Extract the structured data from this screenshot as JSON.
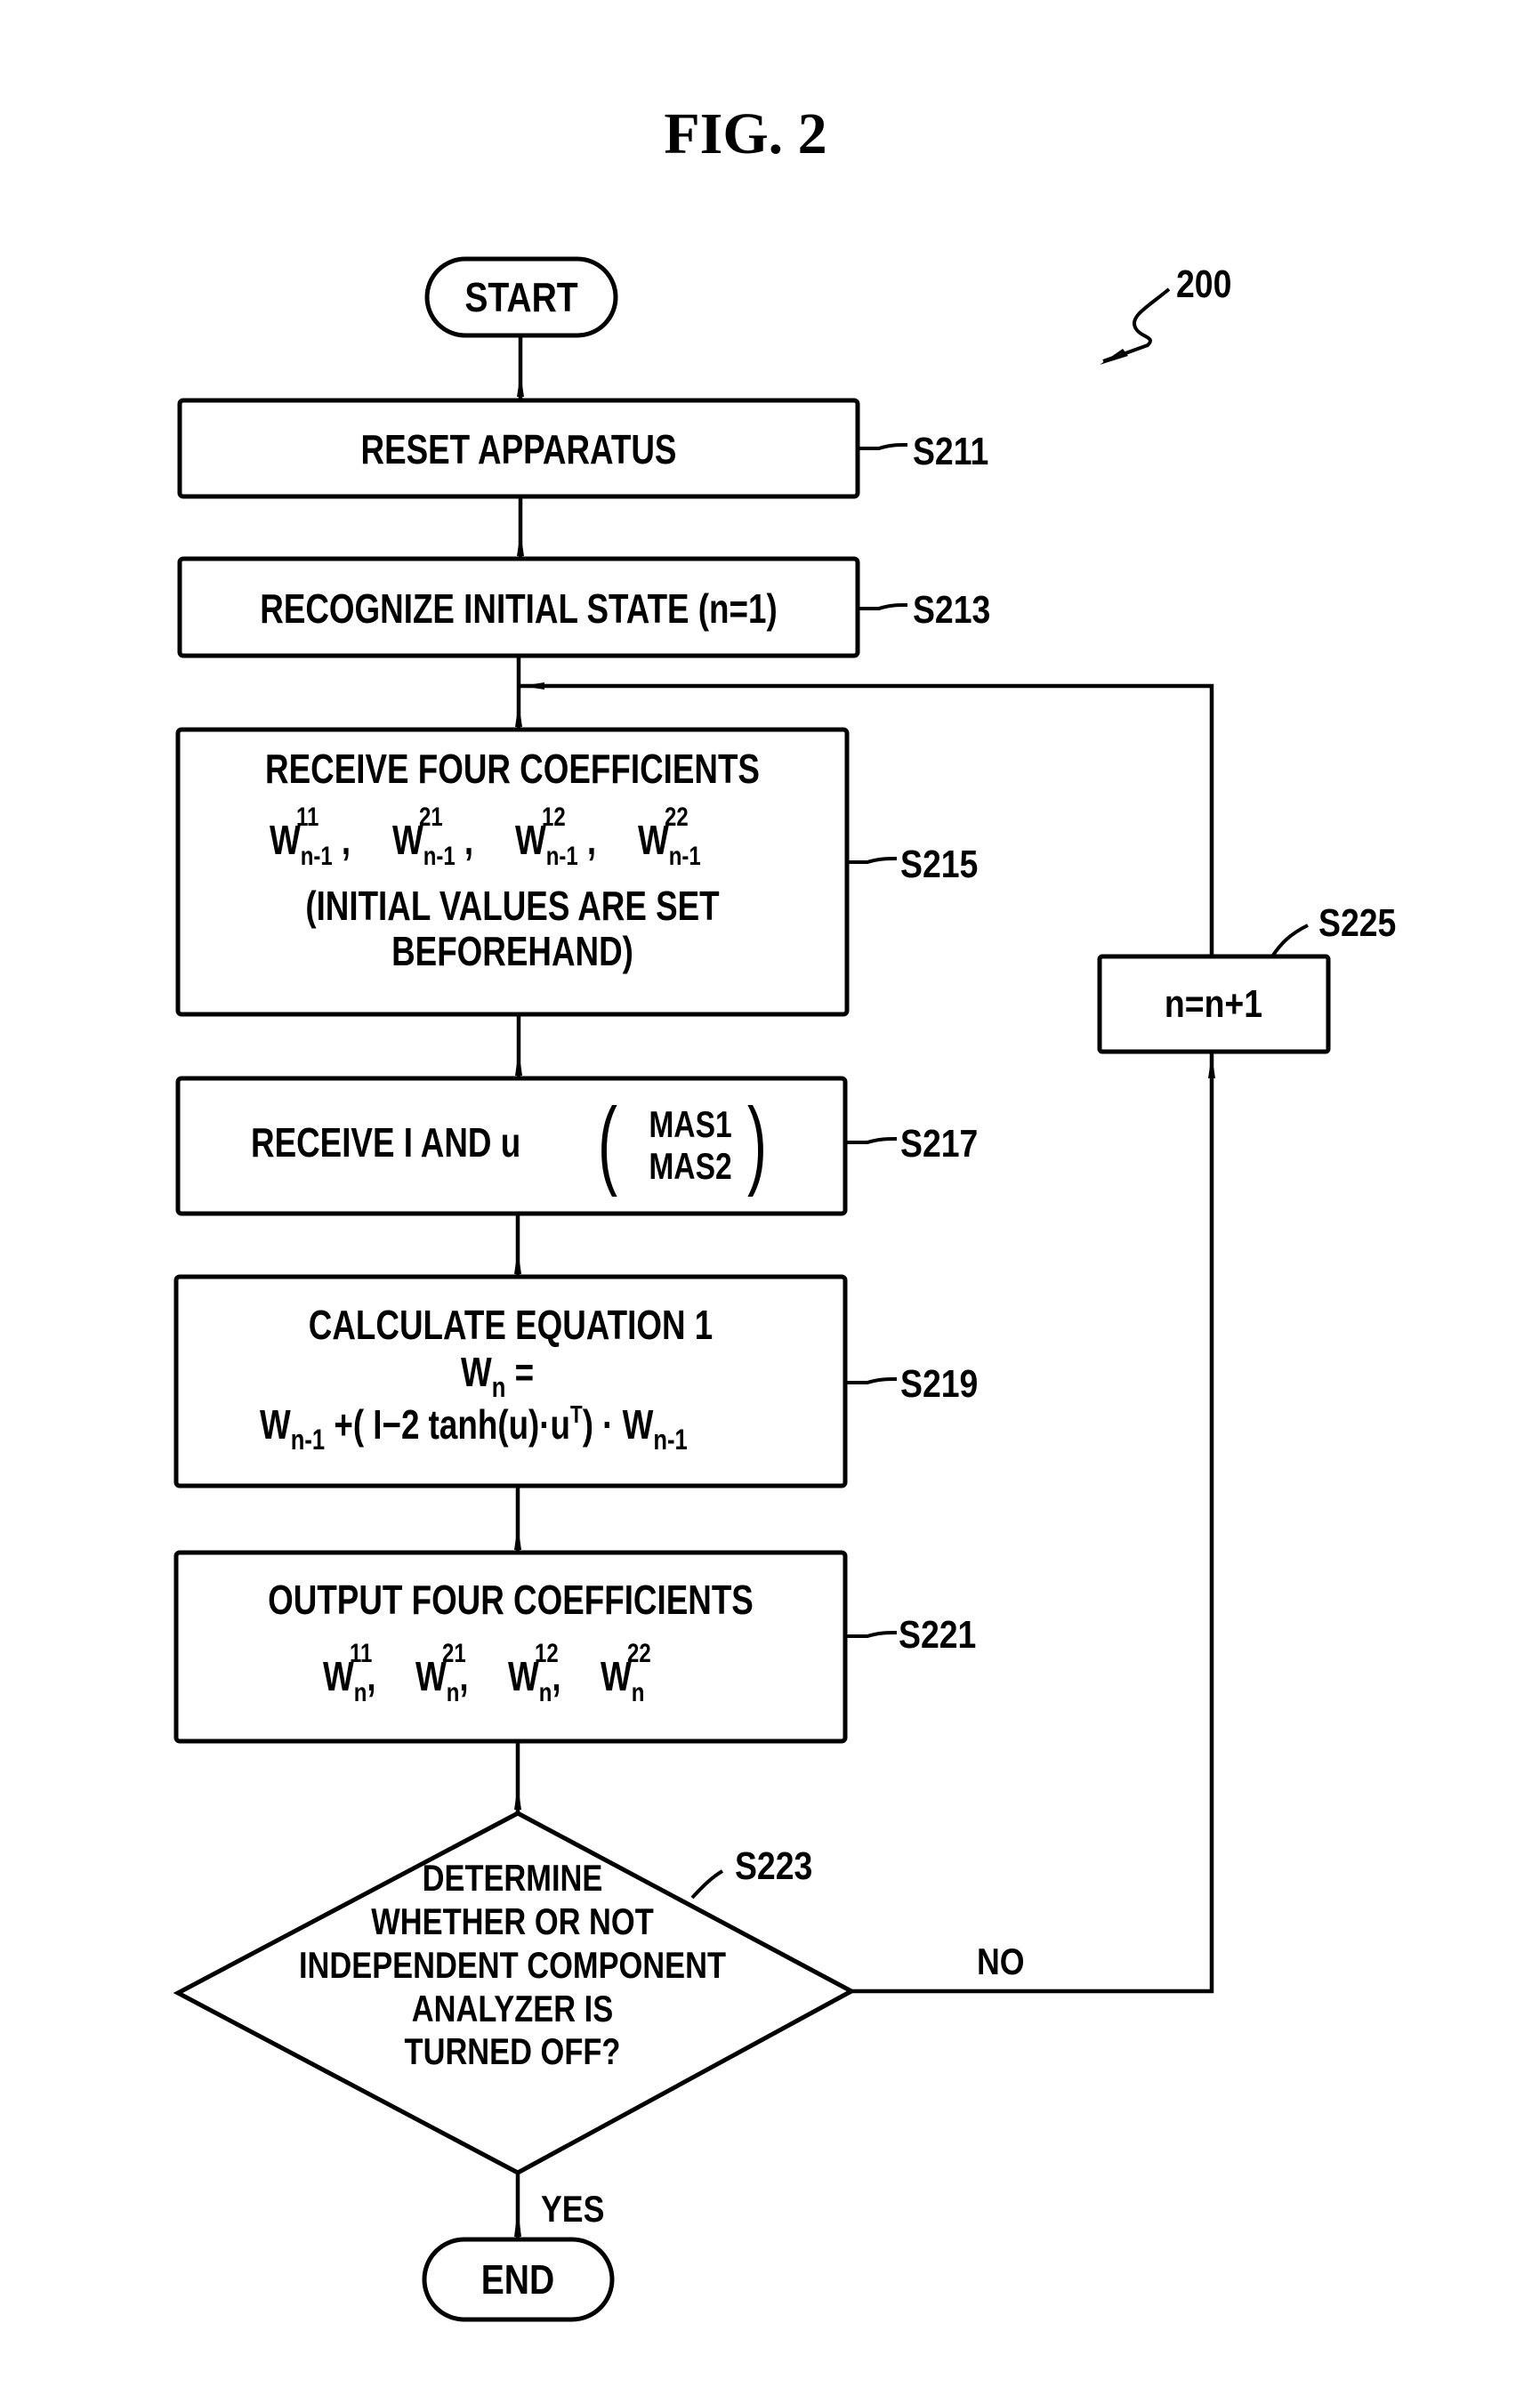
{
  "figure": {
    "title": "FIG. 2",
    "reference_number": "200"
  },
  "flowchart": {
    "start": {
      "label": "START"
    },
    "end": {
      "label": "END"
    },
    "steps": [
      {
        "id": "S211",
        "lines": [
          "RESET APPARATUS"
        ]
      },
      {
        "id": "S213",
        "lines": [
          "RECOGNIZE INITIAL STATE (n=1)"
        ]
      },
      {
        "id": "S215",
        "lines": [
          "RECEIVE FOUR COEFFICIENTS",
          "W¹¹ₙ₋₁ , W²¹ₙ₋₁ , W¹²ₙ₋₁ , W²²ₙ₋₁",
          "(INITIAL VALUES ARE SET",
          "BEFOREHAND)"
        ],
        "coefficients": [
          {
            "base": "W",
            "sup": "11",
            "sub": "n-1"
          },
          {
            "base": "W",
            "sup": "21",
            "sub": "n-1"
          },
          {
            "base": "W",
            "sup": "12",
            "sub": "n-1"
          },
          {
            "base": "W",
            "sup": "22",
            "sub": "n-1"
          }
        ],
        "text_top": "RECEIVE FOUR COEFFICIENTS",
        "text_bottom_1": "(INITIAL VALUES ARE SET",
        "text_bottom_2": "BEFOREHAND)"
      },
      {
        "id": "S217",
        "text": "RECEIVE I AND u",
        "paren_top": "MAS1",
        "paren_bottom": "MAS2"
      },
      {
        "id": "S219",
        "line1": "CALCULATE EQUATION 1",
        "line2_base": "W",
        "line2_sub": "n",
        "line2_rest": " =",
        "line3": {
          "w1_sub": "n-1",
          "middle": " +( I−2 tanh(u)·u",
          "sup_T": "T",
          "close": ") · W",
          "w2_sub": "n-1"
        }
      },
      {
        "id": "S221",
        "text_top": "OUTPUT FOUR COEFFICIENTS",
        "coefficients": [
          {
            "base": "W",
            "sup": "11",
            "sub": "n"
          },
          {
            "base": "W",
            "sup": "21",
            "sub": "n"
          },
          {
            "base": "W",
            "sup": "12",
            "sub": "n"
          },
          {
            "base": "W",
            "sup": "22",
            "sub": "n"
          }
        ]
      },
      {
        "id": "S225",
        "lines": [
          "n=n+1"
        ]
      }
    ],
    "decision": {
      "id": "S223",
      "lines": [
        "DETERMINE",
        "WHETHER OR NOT",
        "INDEPENDENT COMPONENT",
        "ANALYZER IS",
        "TURNED OFF?"
      ],
      "yes_label": "YES",
      "no_label": "NO"
    }
  }
}
